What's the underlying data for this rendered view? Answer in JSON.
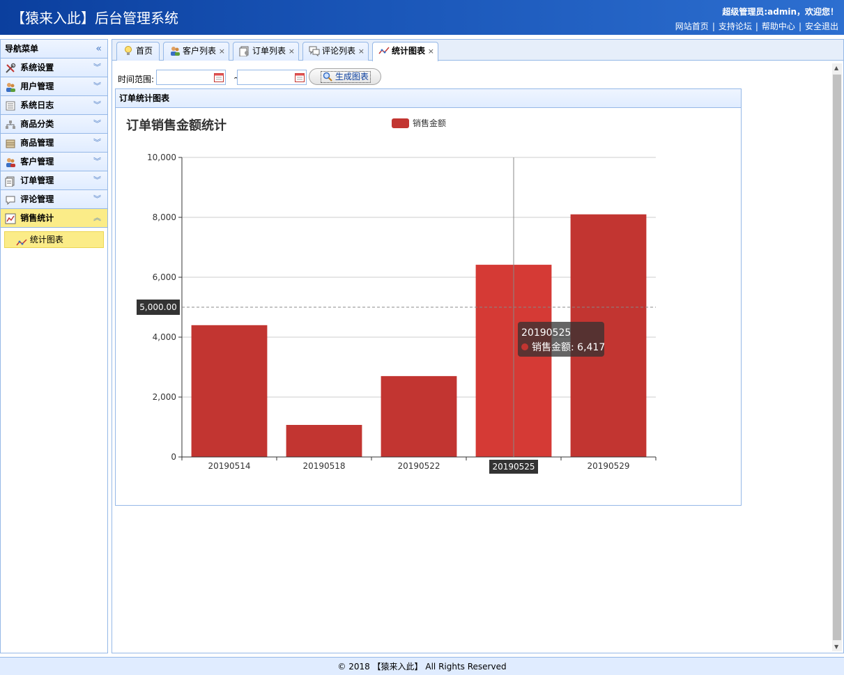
{
  "header": {
    "title": "【猿来入此】后台管理系统",
    "welcome": "超级管理员:admin，欢迎您！",
    "links": [
      "网站首页",
      "支持论坛",
      "帮助中心",
      "安全退出"
    ]
  },
  "sidebar": {
    "title": "导航菜单",
    "items": [
      {
        "label": "系统设置",
        "icon": "tools-icon"
      },
      {
        "label": "用户管理",
        "icon": "users-icon"
      },
      {
        "label": "系统日志",
        "icon": "log-icon"
      },
      {
        "label": "商品分类",
        "icon": "category-icon"
      },
      {
        "label": "商品管理",
        "icon": "goods-icon"
      },
      {
        "label": "客户管理",
        "icon": "customers-icon"
      },
      {
        "label": "订单管理",
        "icon": "orders-icon"
      },
      {
        "label": "评论管理",
        "icon": "comment-icon"
      },
      {
        "label": "销售统计",
        "icon": "chart-icon"
      }
    ],
    "submenu": {
      "label": "统计图表"
    }
  },
  "tabs": [
    {
      "label": "首页"
    },
    {
      "label": "客户列表"
    },
    {
      "label": "订单列表"
    },
    {
      "label": "评论列表"
    },
    {
      "label": "统计图表"
    }
  ],
  "toolbar": {
    "range_label": "时间范围:",
    "tilde": "~",
    "start_value": "",
    "end_value": "",
    "button_label": "生成图表"
  },
  "panel": {
    "title": "订单统计图表"
  },
  "chart_data": {
    "type": "bar",
    "title": "订单销售金额统计",
    "categories": [
      "20190514",
      "20190518",
      "20190522",
      "20190525",
      "20190529"
    ],
    "series": [
      {
        "name": "销售金额",
        "values": [
          4400,
          1070,
          2700,
          6417,
          8100
        ]
      }
    ],
    "ylim": [
      0,
      10000
    ],
    "yticks": [
      "0",
      "2,000",
      "4,000",
      "6,000",
      "8,000",
      "10,000"
    ],
    "yticks_values": [
      0,
      2000,
      4000,
      6000,
      8000,
      10000
    ],
    "color": "#c23531",
    "highlight_color": "#d53a35",
    "grid": true,
    "legend_position": "top",
    "mark_line": {
      "value": 5000,
      "label": "5,000.00"
    },
    "tooltip": {
      "category": "20190525",
      "series": "销售金额",
      "value": "6,417"
    },
    "axis_pointer_label": "20190525"
  },
  "footer": {
    "text": "© 2018 【猿来入此】 All Rights Reserved"
  }
}
